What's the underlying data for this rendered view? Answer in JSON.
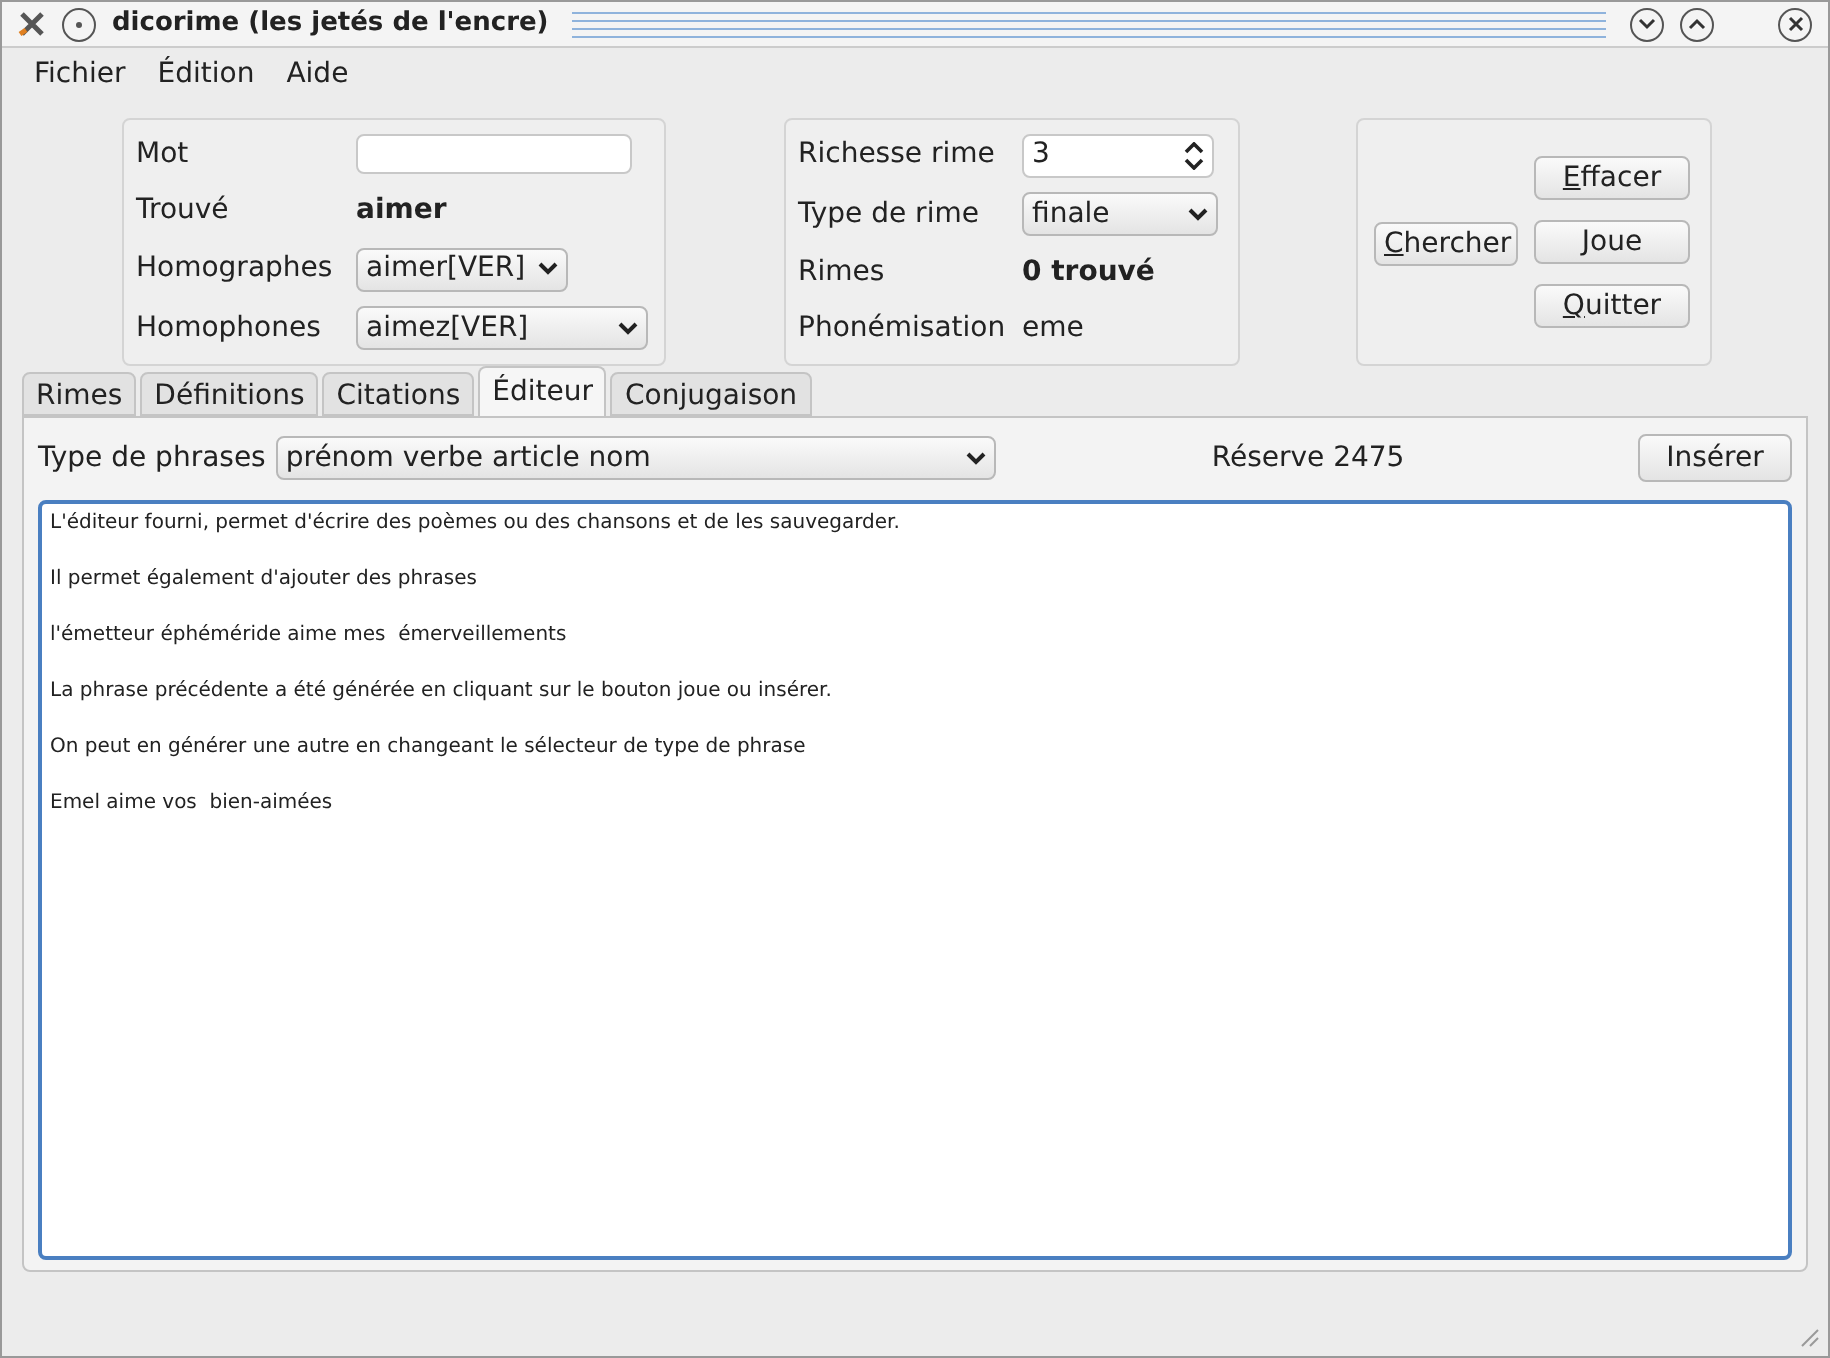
{
  "window": {
    "title": "dicorime (les jetés de l'encre)"
  },
  "menu": [
    "Fichier",
    "Édition",
    "Aide"
  ],
  "word_panel": {
    "mot": {
      "label": "Mot"
    },
    "trouve": {
      "label": "Trouvé",
      "value": "aimer"
    },
    "homographes": {
      "label": "Homographes",
      "value": "aimer[VER]"
    },
    "homophones": {
      "label": "Homophones",
      "value": "aimez[VER]"
    }
  },
  "rhyme_panel": {
    "richesse": {
      "label": "Richesse rime",
      "value": "3"
    },
    "type": {
      "label": "Type de rime",
      "value": "finale"
    },
    "rimes": {
      "label": "Rimes",
      "value": "0 trouvé"
    },
    "phonemisation": {
      "label": "Phonémisation",
      "value": "eme"
    }
  },
  "buttons": [
    {
      "label": "Chercher",
      "underline_first": true,
      "kind": "side"
    },
    {
      "label": "Effacer",
      "underline_first": true,
      "kind": "stack"
    },
    {
      "label": "Joue",
      "underline_first": false,
      "kind": "stack"
    },
    {
      "label": "Quitter",
      "underline_first": true,
      "kind": "stack"
    }
  ],
  "tabs": [
    {
      "label": "Rimes",
      "selected": false
    },
    {
      "label": "Définitions",
      "selected": false
    },
    {
      "label": "Citations",
      "selected": false
    },
    {
      "label": "Éditeur",
      "selected": true
    },
    {
      "label": "Conjugaison",
      "selected": false
    }
  ],
  "editor": {
    "phrase_type": {
      "label": "Type de phrases",
      "value": "prénom verbe article nom"
    },
    "reserve": "Réserve 2475",
    "insert_button": "Insérer",
    "lines": [
      "L'éditeur fourni, permet d'écrire des poèmes ou des chansons et de les sauvegarder.",
      "Il permet également d'ajouter des phrases",
      "l'émetteur éphéméride aime mes  émerveillements",
      "La phrase précédente a été générée en cliquant sur le bouton joue ou insérer.",
      "On peut en générer une autre en changeant le sélecteur de type de phrase",
      "Emel aime vos  bien-aimées"
    ]
  }
}
